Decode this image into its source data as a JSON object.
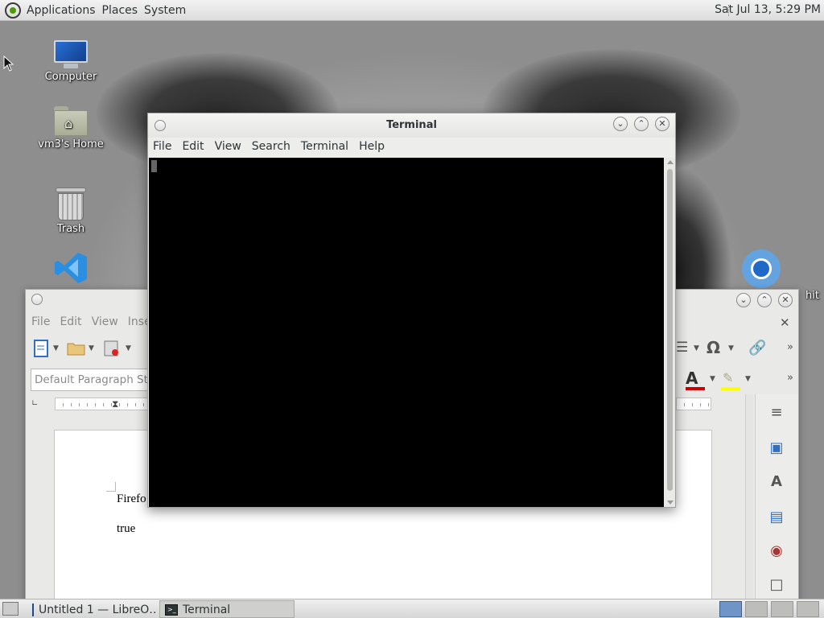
{
  "top_panel": {
    "menus": [
      "Applications",
      "Places",
      "System"
    ],
    "clock": "Sat Jul 13,  5:29 PM"
  },
  "desktop": {
    "icons": [
      {
        "label": "Computer",
        "icon": "computer-icon"
      },
      {
        "label": "vm3's Home",
        "icon": "home-folder-icon"
      },
      {
        "label": "Trash",
        "icon": "trash-icon"
      },
      {
        "label": "",
        "icon": "vscode-icon"
      }
    ],
    "partial_right_label": "hit"
  },
  "terminal": {
    "title": "Terminal",
    "menu": [
      "File",
      "Edit",
      "View",
      "Search",
      "Terminal",
      "Help"
    ],
    "background": "#000000"
  },
  "writer": {
    "menu": [
      "File",
      "Edit",
      "View",
      "Insert"
    ],
    "paragraph_style": "Default Paragraph Style",
    "doc_lines": [
      "Firefo",
      "true"
    ],
    "colors": {
      "font_color": "#cc0000",
      "highlight": "#ffff00"
    }
  },
  "taskbar": {
    "tasks": [
      {
        "label": "Untitled 1 — LibreO…",
        "icon": "libreoffice-writer-icon"
      },
      {
        "label": "Terminal",
        "icon": "terminal-icon"
      }
    ]
  }
}
